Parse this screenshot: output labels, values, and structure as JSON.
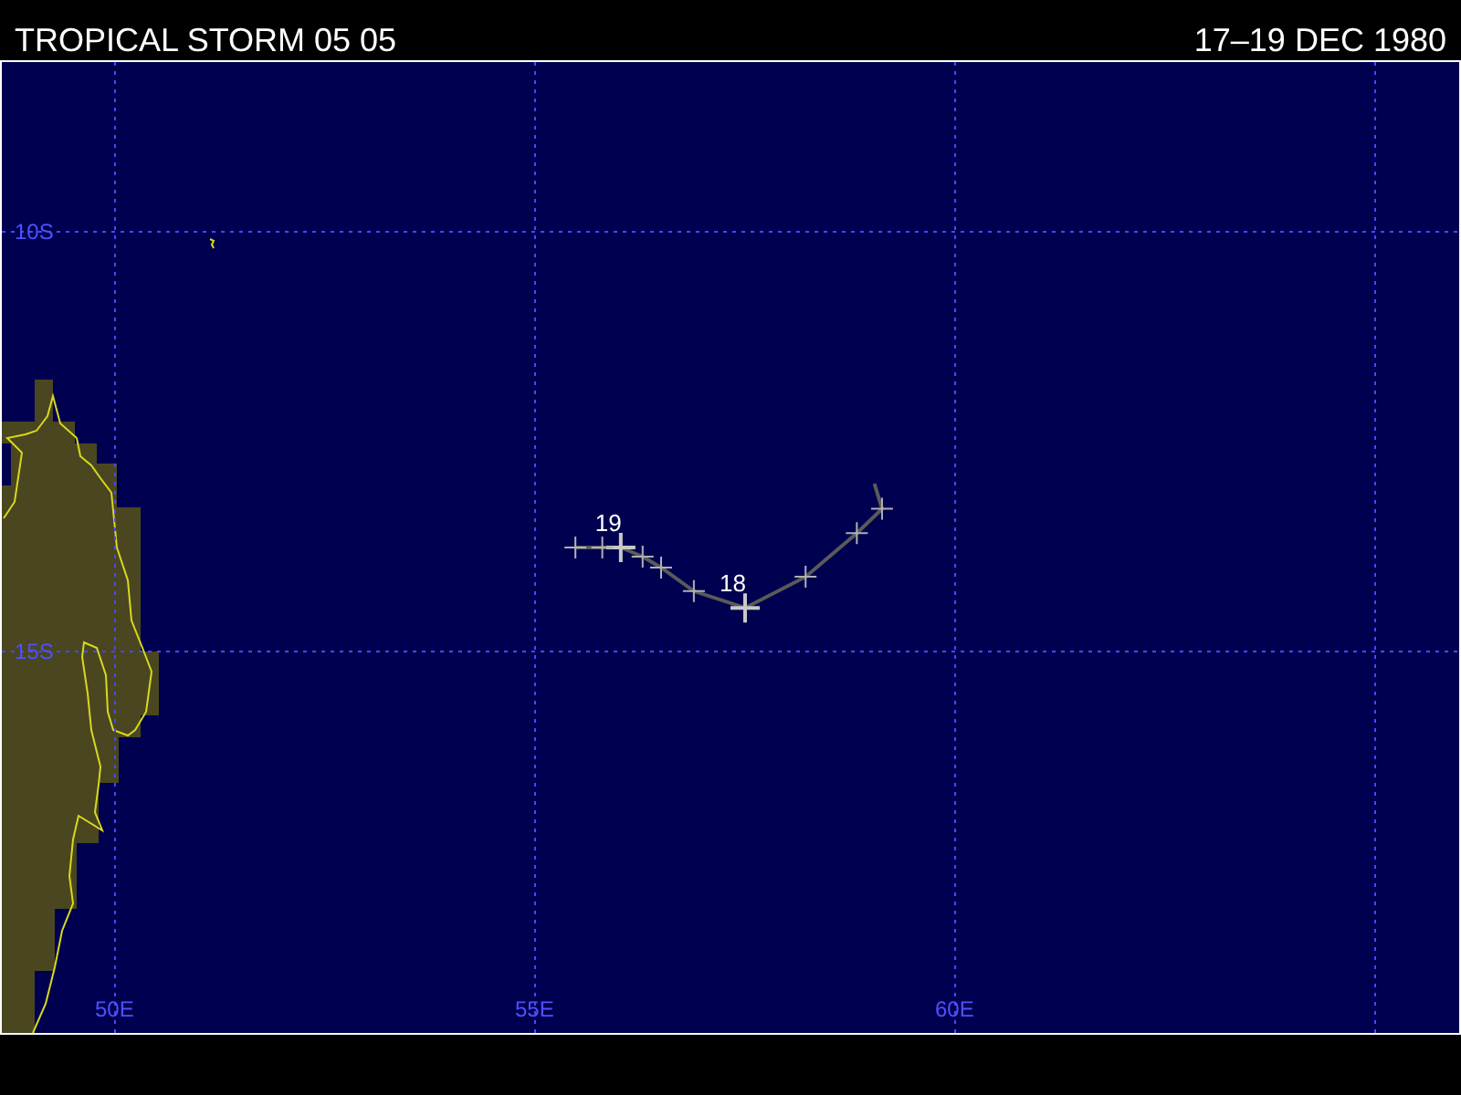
{
  "header": {
    "title": "TROPICAL STORM 05 05",
    "dates": "17–19 DEC 1980"
  },
  "map": {
    "lon_labels": [
      "50E",
      "55E",
      "60E"
    ],
    "lat_labels": [
      "10S",
      "15S"
    ],
    "track": [
      {
        "kind": "start"
      },
      {
        "kind": "minor"
      },
      {
        "kind": "minor"
      },
      {
        "kind": "minor"
      },
      {
        "kind": "major",
        "label": "18"
      },
      {
        "kind": "minor"
      },
      {
        "kind": "minor"
      },
      {
        "kind": "minor"
      },
      {
        "kind": "major",
        "label": "19"
      },
      {
        "kind": "minor"
      },
      {
        "kind": "minor"
      }
    ]
  }
}
